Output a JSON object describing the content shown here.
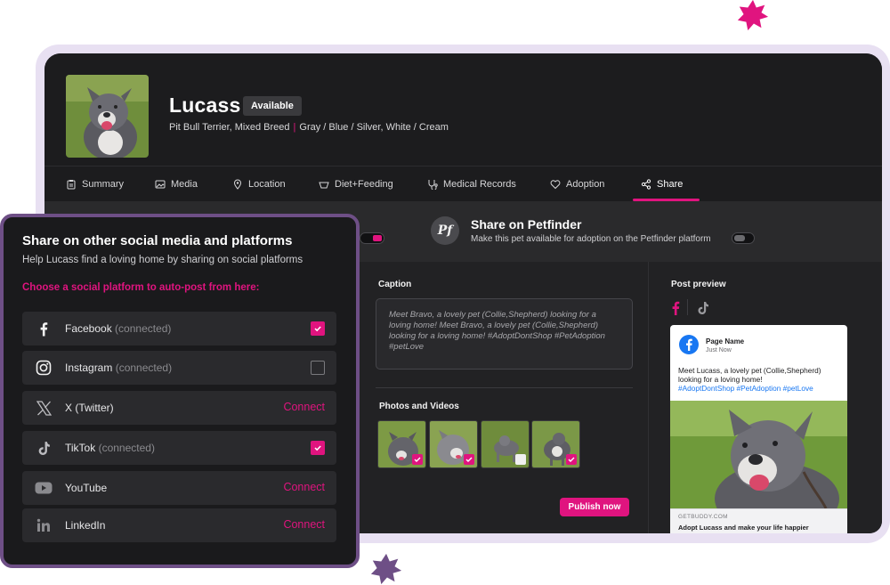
{
  "colors": {
    "accent": "#e0147f",
    "panel_border": "#6e4f86",
    "background": "#1b1b1d",
    "facebook_blue": "#1877f2"
  },
  "pet": {
    "name": "Lucass",
    "status": "Available",
    "breed": "Pit Bull Terrier, Mixed Breed",
    "colors_text": "Gray / Blue / Silver, White / Cream",
    "photo_icon": "dog-photo"
  },
  "tabs": [
    {
      "label": "Summary",
      "icon": "clipboard-icon"
    },
    {
      "label": "Media",
      "icon": "image-icon"
    },
    {
      "label": "Location",
      "icon": "map-pin-icon"
    },
    {
      "label": "Diet+Feeding",
      "icon": "bowl-icon"
    },
    {
      "label": "Medical Records",
      "icon": "stethoscope-icon"
    },
    {
      "label": "Adoption",
      "icon": "heart-icon"
    },
    {
      "label": "Share",
      "icon": "share-icon",
      "active": true
    }
  ],
  "petfinder": {
    "logo_text": "Pf",
    "title": "Share on Petfinder",
    "subtitle": "Make this pet available for adoption on the Petfinder platform",
    "enabled": false
  },
  "caption": {
    "label": "Caption",
    "text": "Meet Bravo, a lovely pet (Collie,Shepherd) looking for a loving home! Meet Bravo, a lovely pet (Collie,Shepherd) looking for a loving home!  #AdoptDontShop #PetAdoption #petLove"
  },
  "media": {
    "label": "Photos and Videos",
    "items": [
      {
        "selected": true
      },
      {
        "selected": true
      },
      {
        "selected": false
      },
      {
        "selected": true
      }
    ]
  },
  "publish_label": "Publish now",
  "preview": {
    "label": "Post preview",
    "platform_tabs": [
      "facebook-icon",
      "tiktok-icon"
    ],
    "page_name": "Page Name",
    "time": "Just Now",
    "post_text": "Meet Lucass, a lovely pet (Collie,Shepherd) looking for a loving home!",
    "hashtags": "#AdoptDontShop #PetAdoption #petLove",
    "domain": "GETBUDDY.COM",
    "link_title": "Adopt Lucass and make your life happier"
  },
  "social": {
    "title": "Share on other social media and platforms",
    "subtitle": "Help Lucass find a loving home by sharing on social platforms",
    "choose_label": "Choose a social platform to auto-post from here:",
    "platforms": [
      {
        "name": "Facebook",
        "status": "(connected)",
        "icon": "facebook-icon",
        "checked": true,
        "action": ""
      },
      {
        "name": "Instagram",
        "status": "(connected)",
        "icon": "instagram-icon",
        "checked": false,
        "action": ""
      },
      {
        "name": "X (Twitter)",
        "status": "",
        "icon": "x-twitter-icon",
        "checked": null,
        "action": "Connect"
      },
      {
        "name": "TikTok",
        "status": "(connected)",
        "icon": "tiktok-icon",
        "checked": true,
        "action": ""
      },
      {
        "name": "YouTube",
        "status": "",
        "icon": "youtube-icon",
        "checked": null,
        "action": "Connect"
      },
      {
        "name": "LinkedIn",
        "status": "",
        "icon": "linkedin-icon",
        "checked": null,
        "action": "Connect"
      }
    ]
  }
}
